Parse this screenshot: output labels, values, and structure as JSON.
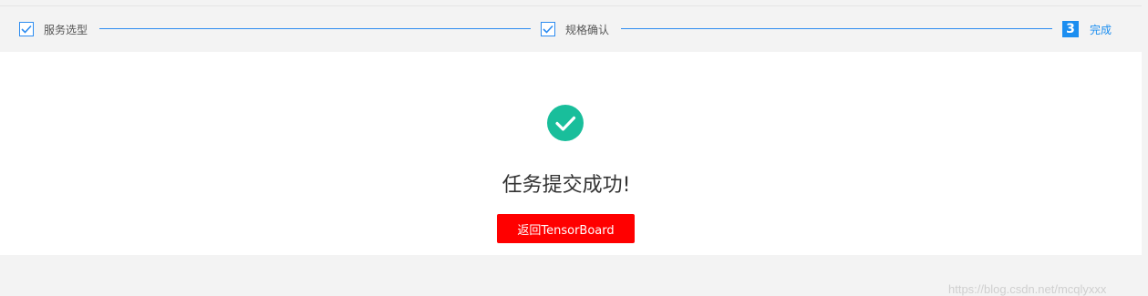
{
  "steps": [
    {
      "label": "服务选型",
      "state": "done"
    },
    {
      "label": "规格确认",
      "state": "done"
    },
    {
      "number": "3",
      "label": "完成",
      "state": "active"
    }
  ],
  "result": {
    "message": "任务提交成功!",
    "button_label": "返回TensorBoard"
  },
  "watermark": "https://blog.csdn.net/mcqlyxxx",
  "colors": {
    "accent": "#2d8cf0",
    "success": "#19be9b",
    "button": "#ff0000"
  }
}
